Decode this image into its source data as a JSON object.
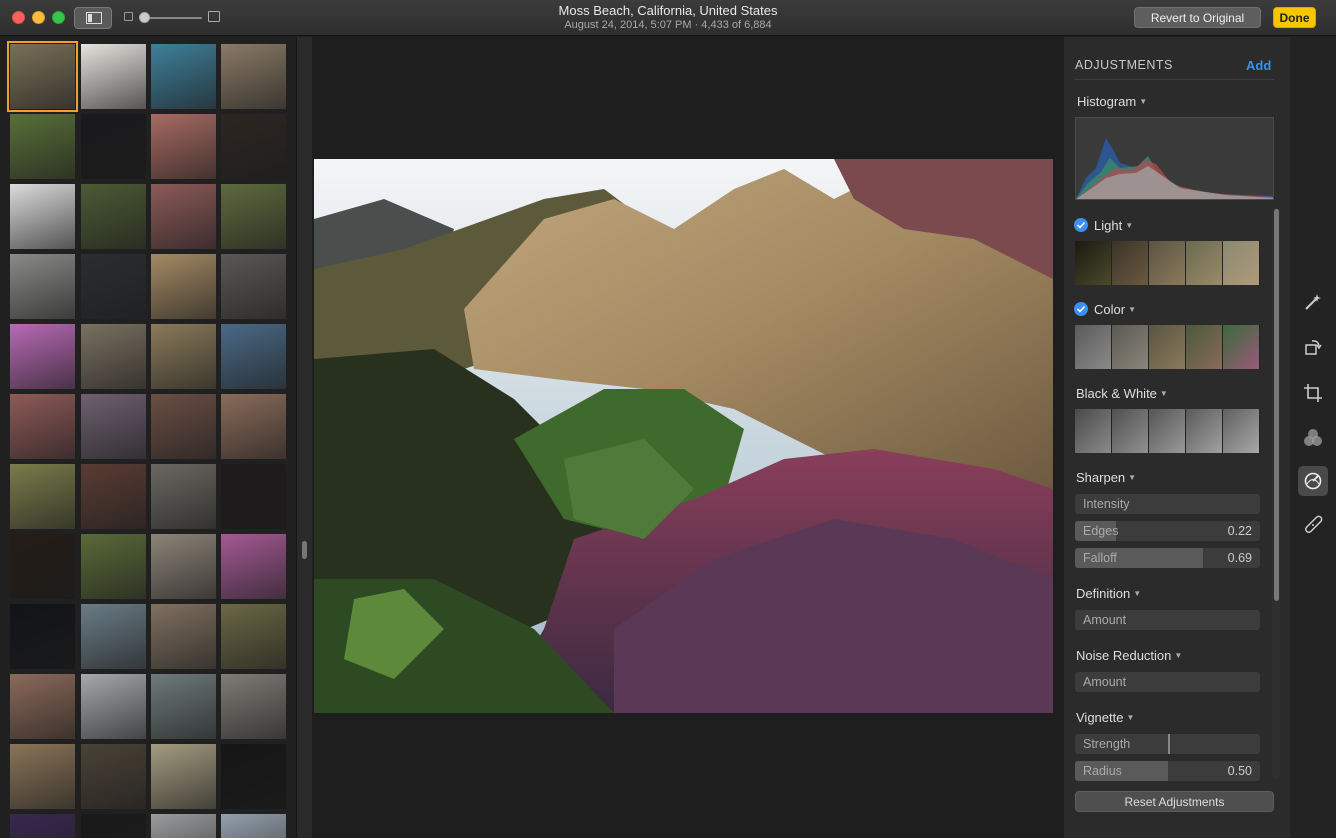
{
  "window": {
    "title": "Moss Beach, California, United States",
    "subtitle": "August 24, 2014, 5:07 PM   ·   4,433 of 6,884",
    "revert_label": "Revert to Original",
    "done_label": "Done"
  },
  "thumbnails": {
    "selected_index": 0,
    "colors": [
      [
        "#7a7058",
        "#e6e2de",
        "#3f7f9a",
        "#8a7a66"
      ],
      [
        "#587038",
        "#1a1a1c",
        "#a86a62",
        "#2c2622"
      ],
      [
        "#dcdcdc",
        "#4c5a34",
        "#8c5a58",
        "#5e6a3e"
      ],
      [
        "#8a8a88",
        "#2a2e30",
        "#a48a64",
        "#5a5854"
      ],
      [
        "#b86ab6",
        "#7a7060",
        "#8a7a5a",
        "#4a6a86"
      ],
      [
        "#8e5a58",
        "#6e6070",
        "#6a4e44",
        "#8a6c5a"
      ],
      [
        "#7a7c4a",
        "#5a3c34",
        "#6a6862",
        "#1e1a1c"
      ],
      [
        "#241c16",
        "#5a6a38",
        "#8c8478",
        "#a45a94"
      ],
      [
        "#121418",
        "#6a7c86",
        "#807060",
        "#6a6844"
      ],
      [
        "#8c6a5a",
        "#a6a8aa",
        "#6e7a7a",
        "#7e7c76"
      ],
      [
        "#8a7458",
        "#4a4236",
        "#a49c80",
        "#161616"
      ],
      [
        "#382850",
        "#1a1a1a",
        "#9a9c9e",
        "#94a0ac"
      ]
    ]
  },
  "adjustments": {
    "title": "ADJUSTMENTS",
    "add_label": "Add",
    "histogram_label": "Histogram",
    "light_label": "Light",
    "color_label": "Color",
    "bw_label": "Black & White",
    "sharpen_label": "Sharpen",
    "intensity_label": "Intensity",
    "edges_label": "Edges",
    "edges_value": "0.22",
    "edges_fraction": 0.22,
    "falloff_label": "Falloff",
    "falloff_value": "0.69",
    "falloff_fraction": 0.69,
    "definition_label": "Definition",
    "definition_amount_label": "Amount",
    "noise_label": "Noise Reduction",
    "noise_amount_label": "Amount",
    "vignette_label": "Vignette",
    "strength_label": "Strength",
    "strength_fraction": 0.5,
    "radius_label": "Radius",
    "radius_value": "0.50",
    "radius_fraction": 0.5,
    "reset_label": "Reset Adjustments",
    "colors": {
      "accent": "#3b8ff6",
      "done": "#f7c600"
    }
  },
  "tools": [
    "magic-wand-icon",
    "rotate-icon",
    "crop-icon",
    "filters-icon",
    "adjust-icon",
    "retouch-icon"
  ]
}
